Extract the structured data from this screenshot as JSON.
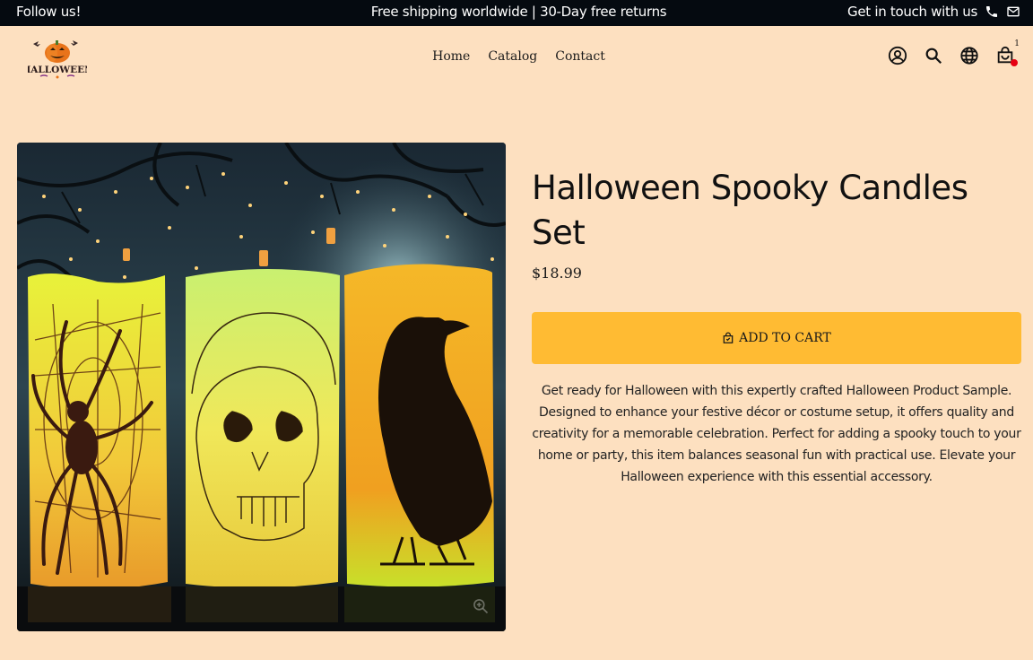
{
  "topbar": {
    "follow": "Follow us!",
    "promo": "Free shipping worldwide | 30-Day free returns",
    "contact": "Get in touch with us"
  },
  "logo": {
    "text": "HALLOWEEN"
  },
  "nav": [
    "Home",
    "Catalog",
    "Contact"
  ],
  "cart": {
    "count": "1"
  },
  "product": {
    "title": "Halloween Spooky Candles Set",
    "price": "$18.99",
    "add_to_cart": "ADD TO CART",
    "description": "Get ready for Halloween with this expertly crafted Halloween Product Sample. Designed to enhance your festive décor or costume setup, it offers quality and creativity for a memorable celebration. Perfect for adding a spooky touch to your home or party, this item balances seasonal fun with practical use. Elevate your Halloween experience with this essential accessory."
  },
  "colors": {
    "background": "#fde0c0",
    "topbar": "#050a10",
    "button": "#ffbb33",
    "cart_dot": "#e60012"
  }
}
